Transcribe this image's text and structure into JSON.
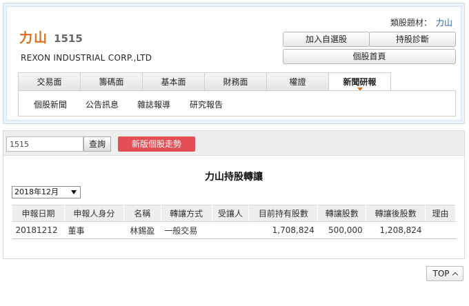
{
  "header": {
    "category_label": "類股題材：",
    "category_value": "力山",
    "stock_name": "力山",
    "stock_code": "1515",
    "company_en": "REXON INDUSTRIAL CORP.,LTD",
    "buttons": {
      "add_watchlist": "加入自選股",
      "holding_diagnosis": "持股診斷",
      "stock_home": "個股首頁"
    }
  },
  "tabs": [
    {
      "label": "交易面",
      "active": false
    },
    {
      "label": "籌碼面",
      "active": false
    },
    {
      "label": "基本面",
      "active": false
    },
    {
      "label": "財務面",
      "active": false
    },
    {
      "label": "權證",
      "active": false
    },
    {
      "label": "新聞研報",
      "active": true
    }
  ],
  "subnav": [
    "個股新聞",
    "公告訊息",
    "雜誌報導",
    "研究報告"
  ],
  "search": {
    "value": "1515",
    "button_label": "查詢",
    "new_trend_label": "新版個股走勢"
  },
  "report": {
    "title": "力山持股轉讓",
    "selected_month": "2018年12月"
  },
  "table": {
    "headers": [
      "申報日期",
      "申報人身分",
      "名稱",
      "轉讓方式",
      "受讓人",
      "目前持有股數",
      "轉讓股數",
      "轉讓後股數",
      "理由"
    ],
    "rows": [
      [
        "20181212",
        "董事",
        "林錫盈",
        "一般交易",
        "",
        "1,708,824",
        "500,000",
        "1,208,824",
        ""
      ]
    ]
  },
  "footer": {
    "top_label": "TOP"
  }
}
